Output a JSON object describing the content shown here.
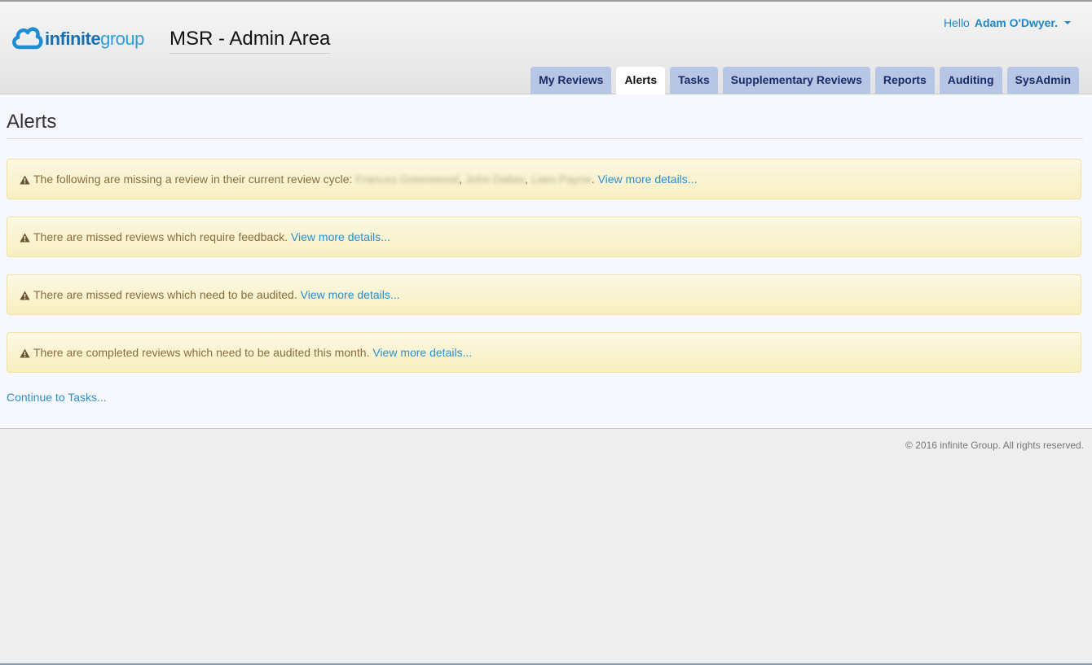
{
  "brand": {
    "logo_word1": "infinite",
    "logo_word2": "group"
  },
  "header": {
    "app_title": "MSR - Admin Area"
  },
  "user": {
    "greeting": "Hello",
    "name": "Adam O'Dwyer."
  },
  "tabs": [
    {
      "label": "My Reviews"
    },
    {
      "label": "Alerts",
      "active": true
    },
    {
      "label": "Tasks"
    },
    {
      "label": "Supplementary Reviews"
    },
    {
      "label": "Reports"
    },
    {
      "label": "Auditing"
    },
    {
      "label": "SysAdmin"
    }
  ],
  "page": {
    "title": "Alerts"
  },
  "alerts": [
    {
      "text": "The following are missing a review in their current review cycle:",
      "redacted_names": [
        "Frances Greenwood",
        "John Dallas",
        "Liam Payne"
      ],
      "link": "View more details..."
    },
    {
      "text": "There are missed reviews which require feedback.",
      "link": "View more details..."
    },
    {
      "text": "There are missed reviews which need to be audited.",
      "link": "View more details..."
    },
    {
      "text": "There are completed reviews which need to be audited this month.",
      "link": "View more details..."
    }
  ],
  "continue_link": "Continue to Tasks...",
  "footer": {
    "copyright": "© 2016 infinite Group. All rights reserved."
  },
  "icons": {
    "alert_icon": "warning-triangle-icon",
    "logo_icon": "cloud-logo-icon",
    "dropdown_icon": "caret-down-icon"
  },
  "colors": {
    "link": "#2a8fd0",
    "tab_bg": "#b8c6e6",
    "tab_text": "#1a2a66",
    "alert_bg": "#fcf8e3",
    "alert_text": "#8a6d3b"
  }
}
